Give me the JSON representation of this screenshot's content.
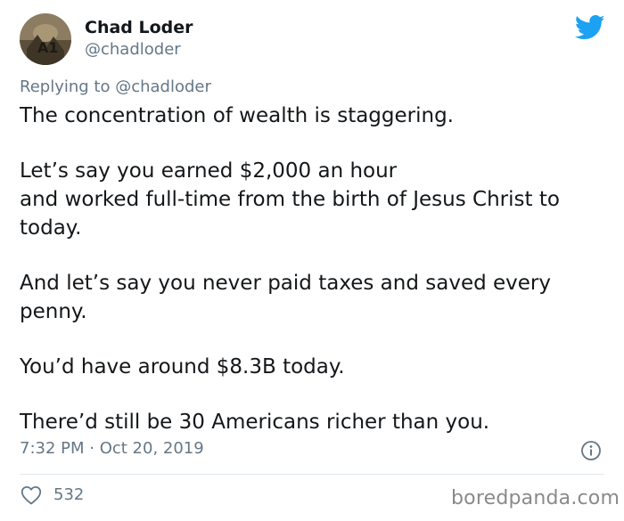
{
  "author": {
    "display_name": "Chad Loder",
    "handle": "@chadloder"
  },
  "reply": {
    "prefix": "Replying to",
    "mention": "@chadloder"
  },
  "tweet": {
    "paragraphs": [
      [
        "The concentration of wealth is staggering."
      ],
      [
        "Let’s say you earned $2,000 an hour",
        "and worked full-time from the birth of Jesus Christ to today."
      ],
      [
        "And let’s say you never paid taxes and saved every penny."
      ],
      [
        "You’d have around $8.3B today."
      ],
      [
        "There’d still be 30 Americans richer than you."
      ]
    ],
    "timestamp": "7:32 PM · Oct 20, 2019",
    "like_count": "532"
  },
  "icons": {
    "brand": "twitter-bird-icon",
    "info": "info-icon",
    "like": "heart-icon"
  },
  "colors": {
    "twitter_blue": "#1da1f2",
    "secondary_text": "#657786",
    "primary_text": "#14171a",
    "divider": "#e1e8ed"
  },
  "watermark": "boredpanda.com"
}
